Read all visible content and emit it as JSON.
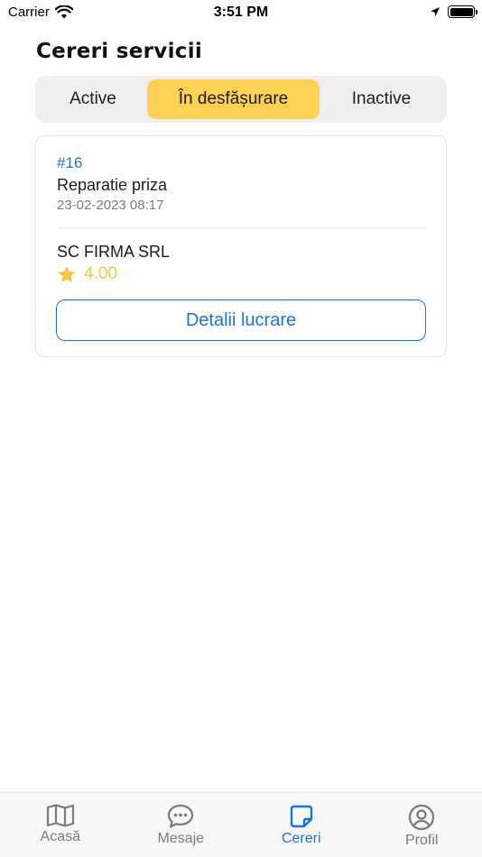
{
  "status_bar": {
    "carrier": "Carrier",
    "time": "3:51 PM"
  },
  "page": {
    "title": "Cereri servicii"
  },
  "segments": {
    "items": [
      "Active",
      "În desfășurare",
      "Inactive"
    ],
    "selected": "În desfășurare"
  },
  "request_card": {
    "id": "#16",
    "title": "Reparatie priza",
    "date": "23-02-2023 08:17",
    "company": "SC FIRMA SRL",
    "rating": "4.00",
    "details_button": "Detalii lucrare"
  },
  "tab_bar": {
    "items": [
      {
        "label": "Acasă",
        "icon": "map-icon"
      },
      {
        "label": "Mesaje",
        "icon": "chat-bubble-icon"
      },
      {
        "label": "Cereri",
        "icon": "note-icon"
      },
      {
        "label": "Profil",
        "icon": "user-circle-icon"
      }
    ],
    "active": "Cereri"
  },
  "colors": {
    "accent": "#1a73d9",
    "segment_active": "#fdd254",
    "star": "#f5c64a"
  }
}
